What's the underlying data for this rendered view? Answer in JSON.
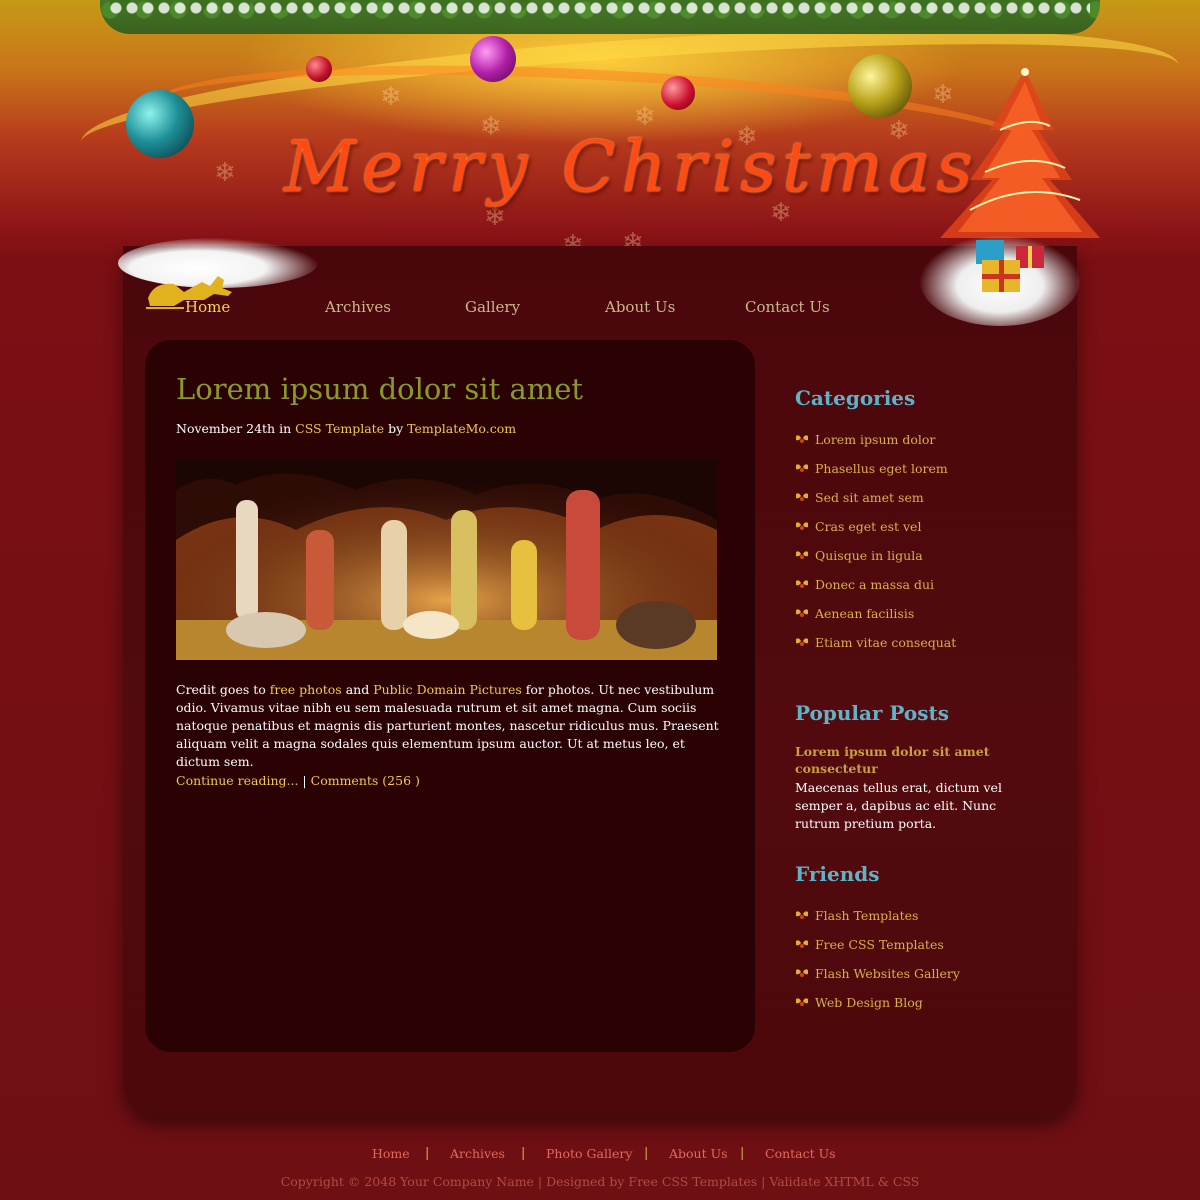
{
  "header": {
    "title": "Merry Christmas"
  },
  "nav": {
    "items": [
      {
        "label": "Home",
        "active": true
      },
      {
        "label": "Archives"
      },
      {
        "label": "Gallery"
      },
      {
        "label": "About Us"
      },
      {
        "label": "Contact Us"
      }
    ]
  },
  "post": {
    "title": "Lorem ipsum dolor sit amet",
    "meta": {
      "date": "November 24th",
      "in_word": "in",
      "category": "CSS Template",
      "by_word": "by",
      "author": "TemplateMo.com"
    },
    "body": {
      "intro": "Credit goes to",
      "link1": "free photos",
      "and_word": "and",
      "link2": "Public Domain Pictures",
      "rest": "for photos. Ut nec vestibulum odio. Vivamus vitae nibh eu sem malesuada rutrum et sit amet magna. Cum sociis natoque penatibus et magnis dis parturient montes, nascetur ridiculus mus. Praesent aliquam velit a magna sodales quis elementum ipsum auctor. Ut at metus leo, et dictum sem."
    },
    "continue_label": "Continue reading...",
    "separator": "|",
    "comments_label": "Comments (256 )"
  },
  "sidebar": {
    "categories": {
      "heading": "Categories",
      "items": [
        "Lorem ipsum dolor",
        "Phasellus eget lorem",
        "Sed sit amet sem",
        "Cras eget est vel",
        "Quisque in ligula",
        "Donec a massa dui",
        "Aenean facilisis",
        "Etiam vitae consequat"
      ]
    },
    "popular": {
      "heading": "Popular Posts",
      "title": "Lorem ipsum dolor sit amet consectetur",
      "body": "Maecenas tellus erat, dictum vel semper a, dapibus ac elit. Nunc rutrum pretium porta."
    },
    "friends": {
      "heading": "Friends",
      "items": [
        "Flash Templates",
        "Free CSS Templates",
        "Flash Websites Gallery",
        "Web Design Blog"
      ]
    }
  },
  "footer": {
    "nav": [
      "Home",
      "Archives",
      "Photo Gallery",
      "About Us",
      "Contact Us"
    ],
    "copyright": "Copyright © 2048 Your Company Name | Designed by Free CSS Templates | Validate XHTML & CSS"
  },
  "colors": {
    "background": "#7a0f14",
    "panel": "#4d080c",
    "post_box": "#2a0204",
    "link": "#f2c94a",
    "heading_sidebar": "#5fb3c8",
    "post_title": "#8a9a2a",
    "title_orange": "#ff4a14"
  }
}
